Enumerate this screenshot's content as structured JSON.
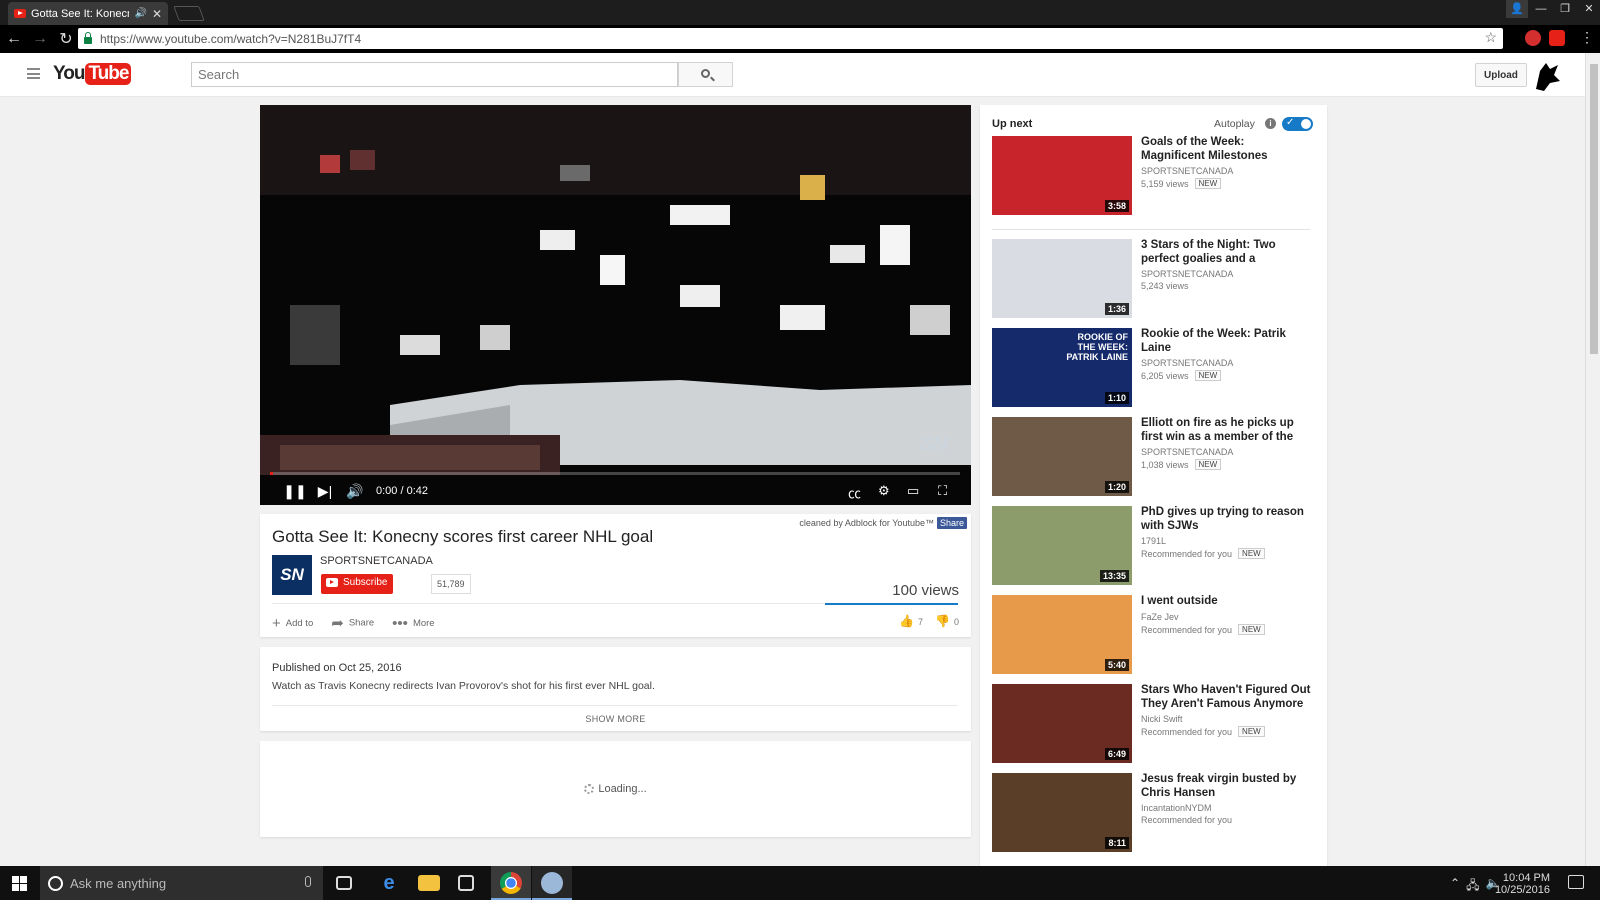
{
  "browser": {
    "tab_title": "Gotta See It: Konecny",
    "url": "https://www.youtube.com/watch?v=N281BuJ7fT4"
  },
  "masthead": {
    "logo_you": "You",
    "logo_tube": "Tube",
    "search_placeholder": "Search",
    "upload_label": "Upload"
  },
  "player": {
    "time": "0:00 / 0:42",
    "progress": 0.005
  },
  "video": {
    "adblock_note": "cleaned by Adblock for Youtube™",
    "adblock_share": "Share",
    "title": "Gotta See It: Konecny scores first career NHL goal",
    "channel_logo": "SN",
    "channel": "SPORTSNETCANADA",
    "subscribe_label": "Subscribe",
    "subscriber_count": "51,789",
    "views": "100 views",
    "actions": {
      "add_to": "Add to",
      "share": "Share",
      "more": "More"
    },
    "likes": "7",
    "dislikes": "0",
    "published": "Published on Oct 25, 2016",
    "description": "Watch as Travis Konecny redirects Ivan Provorov's shot for his first ever NHL goal.",
    "show_more": "SHOW MORE",
    "comments_loading": "Loading..."
  },
  "sidebar": {
    "up_next": "Up next",
    "autoplay": "Autoplay",
    "autoplay_on": true,
    "videos": [
      {
        "title": "Goals of the Week: Magnificent Milestones",
        "channel": "SPORTSNETCANADA",
        "meta": "5,159 views",
        "badge": "NEW",
        "duration": "3:58",
        "thumb_color": "#c8242b"
      },
      {
        "title": "3 Stars of the Night: Two perfect goalies and a",
        "channel": "SPORTSNETCANADA",
        "meta": "5,243 views",
        "badge": "",
        "duration": "1:36",
        "thumb_color": "#d9dde3"
      },
      {
        "title": "Rookie of the Week: Patrik Laine",
        "channel": "SPORTSNETCANADA",
        "meta": "6,205 views",
        "badge": "NEW",
        "duration": "1:10",
        "thumb_color": "#142a6b",
        "thumb_text": "ROOKIE OF THE WEEK: PATRIK LAINE"
      },
      {
        "title": "Elliott on fire as he picks up first win as a member of the",
        "channel": "SPORTSNETCANADA",
        "meta": "1,038 views",
        "badge": "NEW",
        "duration": "1:20",
        "thumb_color": "#6f5a48"
      },
      {
        "title": "PhD gives up trying to reason with SJWs",
        "channel": "1791L",
        "meta": "Recommended for you",
        "badge": "NEW",
        "duration": "13:35",
        "thumb_color": "#8c9c6a"
      },
      {
        "title": "I went outside",
        "channel": "FaZe Jev",
        "meta": "Recommended for you",
        "badge": "NEW",
        "duration": "5:40",
        "thumb_color": "#e79a4a"
      },
      {
        "title": "Stars Who Haven't Figured Out They Aren't Famous Anymore",
        "channel": "Nicki Swift",
        "meta": "Recommended for you",
        "badge": "NEW",
        "duration": "6:49",
        "thumb_color": "#6b2a22"
      },
      {
        "title": "Jesus freak virgin busted by Chris Hansen",
        "channel": "IncantationNYDM",
        "meta": "Recommended for you",
        "badge": "",
        "duration": "8:11",
        "thumb_color": "#5a3e28"
      }
    ]
  },
  "taskbar": {
    "search_placeholder": "Ask me anything",
    "time": "10:04 PM",
    "date": "10/25/2016"
  }
}
